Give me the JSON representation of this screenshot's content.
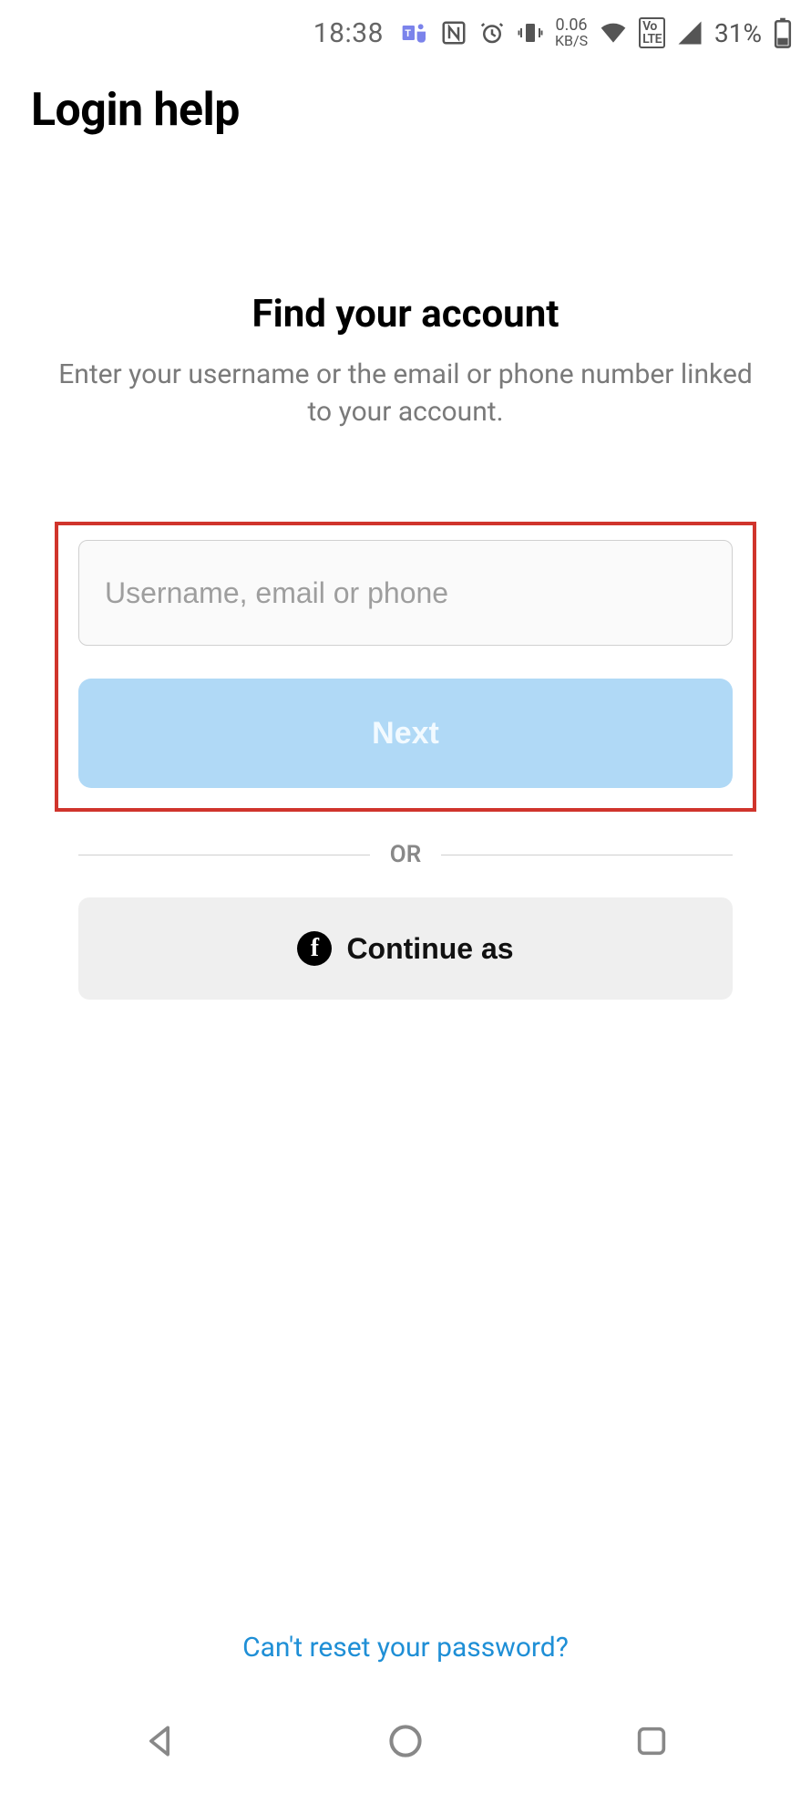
{
  "status": {
    "time": "18:38",
    "data_rate": "0.06",
    "data_unit": "KB/S",
    "battery_pct": "31%"
  },
  "header": {
    "title": "Login help"
  },
  "intro": {
    "title": "Find your account",
    "subtitle": "Enter your username or the email or phone number linked to your account."
  },
  "form": {
    "placeholder": "Username, email or phone",
    "next_label": "Next"
  },
  "divider": {
    "or_label": "OR"
  },
  "fb": {
    "label": "Continue as"
  },
  "footer": {
    "cant_reset": "Can't reset your password?"
  }
}
